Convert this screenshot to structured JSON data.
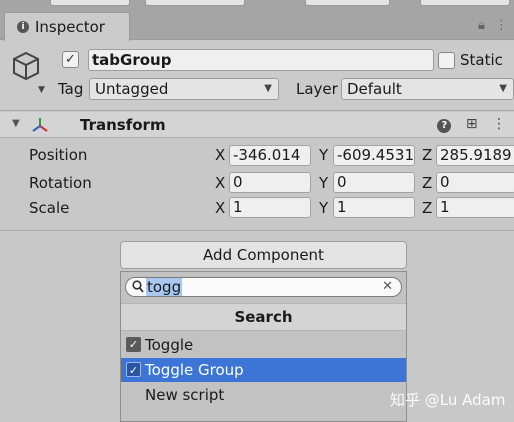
{
  "tab": {
    "label": "Inspector"
  },
  "object": {
    "name": "tabGroup",
    "active": true,
    "static_label": "Static",
    "tag_label": "Tag",
    "tag_value": "Untagged",
    "layer_label": "Layer",
    "layer_value": "Default"
  },
  "transform": {
    "title": "Transform",
    "rows": [
      {
        "label": "Position",
        "x": "-346.014",
        "y": "-609.4531",
        "z": "285.9189"
      },
      {
        "label": "Rotation",
        "x": "0",
        "y": "0",
        "z": "0"
      },
      {
        "label": "Scale",
        "x": "1",
        "y": "1",
        "z": "1"
      }
    ],
    "axis": {
      "x": "X",
      "y": "Y",
      "z": "Z"
    }
  },
  "add_component": {
    "label": "Add Component"
  },
  "popup": {
    "search_value": "togg",
    "header": "Search",
    "items": [
      {
        "label": "Toggle",
        "selected": false,
        "icon": "checkbox-icon"
      },
      {
        "label": "Toggle Group",
        "selected": true,
        "icon": "checkbox-icon"
      },
      {
        "label": "New script",
        "selected": false
      }
    ]
  },
  "watermark": "知乎 @Lu Adam",
  "colors": {
    "selection": "#3d75d6",
    "panel": "#c8c8c8",
    "search_highlight": "#a9c8ef"
  }
}
